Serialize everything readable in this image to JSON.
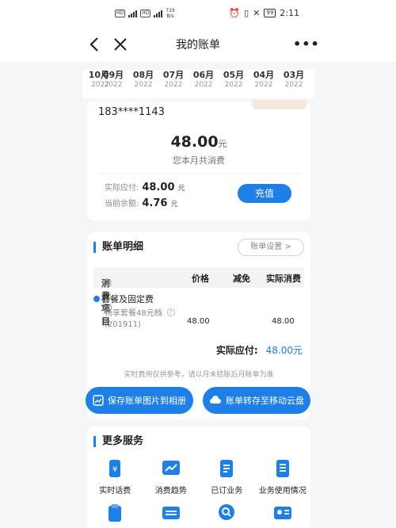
{
  "status_bar": {
    "left_box": "HD",
    "left_box2": "HD",
    "net_speed": "719",
    "net_unit": "B/s",
    "battery": "99",
    "time": "2:11"
  },
  "nav": {
    "title": "我的账单"
  },
  "months": [
    {
      "m": "10月",
      "y": "2022",
      "partial": true
    },
    {
      "m": "09月",
      "y": "2022",
      "active": true
    },
    {
      "m": "08月",
      "y": "2022"
    },
    {
      "m": "07月",
      "y": "2022"
    },
    {
      "m": "06月",
      "y": "2022"
    },
    {
      "m": "05月",
      "y": "2022"
    },
    {
      "m": "04月",
      "y": "2022"
    },
    {
      "m": "03月",
      "y": "2022"
    }
  ],
  "summary": {
    "phone": "183****1143",
    "amount": "48.00",
    "amount_unit": "元",
    "amount_caption": "您本月共消费",
    "payable_label": "实际应付:",
    "payable_value": "48.00",
    "payable_unit": "元",
    "balance_label": "当前余额:",
    "balance_value": "4.76",
    "balance_unit": "元",
    "recharge_label": "充值"
  },
  "bill": {
    "title": "账单明细",
    "settings_label": "账单设置 >",
    "columns": {
      "item": "消费项目",
      "item_unit": "(单位:元)",
      "price": "价格",
      "discount": "减免",
      "actual": "实际消费"
    },
    "group_label": "套餐及固定费",
    "row": {
      "name_line1": "畅享套餐48元档",
      "name_line2": "(201911)",
      "price": "48.00",
      "actual": "48.00"
    },
    "total_label": "实际应付:",
    "total_value": "48.00元",
    "note": "实时费用仅供参考，请以月末结账后月账单为准"
  },
  "actions": {
    "save_label": "保存账单图片到相册",
    "cloud_label": "账单转存至移动云盘"
  },
  "services": {
    "title": "更多服务",
    "items": [
      {
        "label": "实时话费",
        "icon": "phone-bill-icon"
      },
      {
        "label": "消费趋势",
        "icon": "trend-chart-icon"
      },
      {
        "label": "已订业务",
        "icon": "subscribed-list-icon"
      },
      {
        "label": "业务使用情况",
        "icon": "usage-doc-icon"
      }
    ],
    "row2_icons": [
      "clipboard-icon",
      "ticket-icon",
      "search-service-icon",
      "id-card-icon"
    ]
  },
  "colors": {
    "accent": "#1e7fe6",
    "tag": "#f4e9dc"
  }
}
